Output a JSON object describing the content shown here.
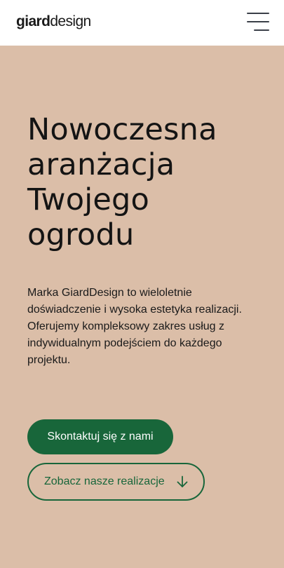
{
  "header": {
    "logo_bold": "giard",
    "logo_light": "design",
    "menu_icon": "hamburger-menu-icon"
  },
  "hero": {
    "title_lines": [
      "Nowoczesna",
      "aranżacja",
      "Twojego",
      "ogrodu"
    ],
    "description_lines": [
      "Marka GiardDesign to wieloletnie",
      "doświadczenie i wysoka estetyka realizacji.",
      "Oferujemy kompleksowy zakres usług z",
      "indywidualnym podejściem do każdego",
      "projektu."
    ],
    "cta_primary": "Skontaktuj się z nami",
    "cta_secondary": "Zobacz nasze realizacje",
    "cta_secondary_icon": "arrow-down-icon"
  },
  "colors": {
    "hero_background": "#dbbea8",
    "brand_green": "#18663a",
    "header_background": "#ffffff",
    "text_dark": "#141414"
  }
}
